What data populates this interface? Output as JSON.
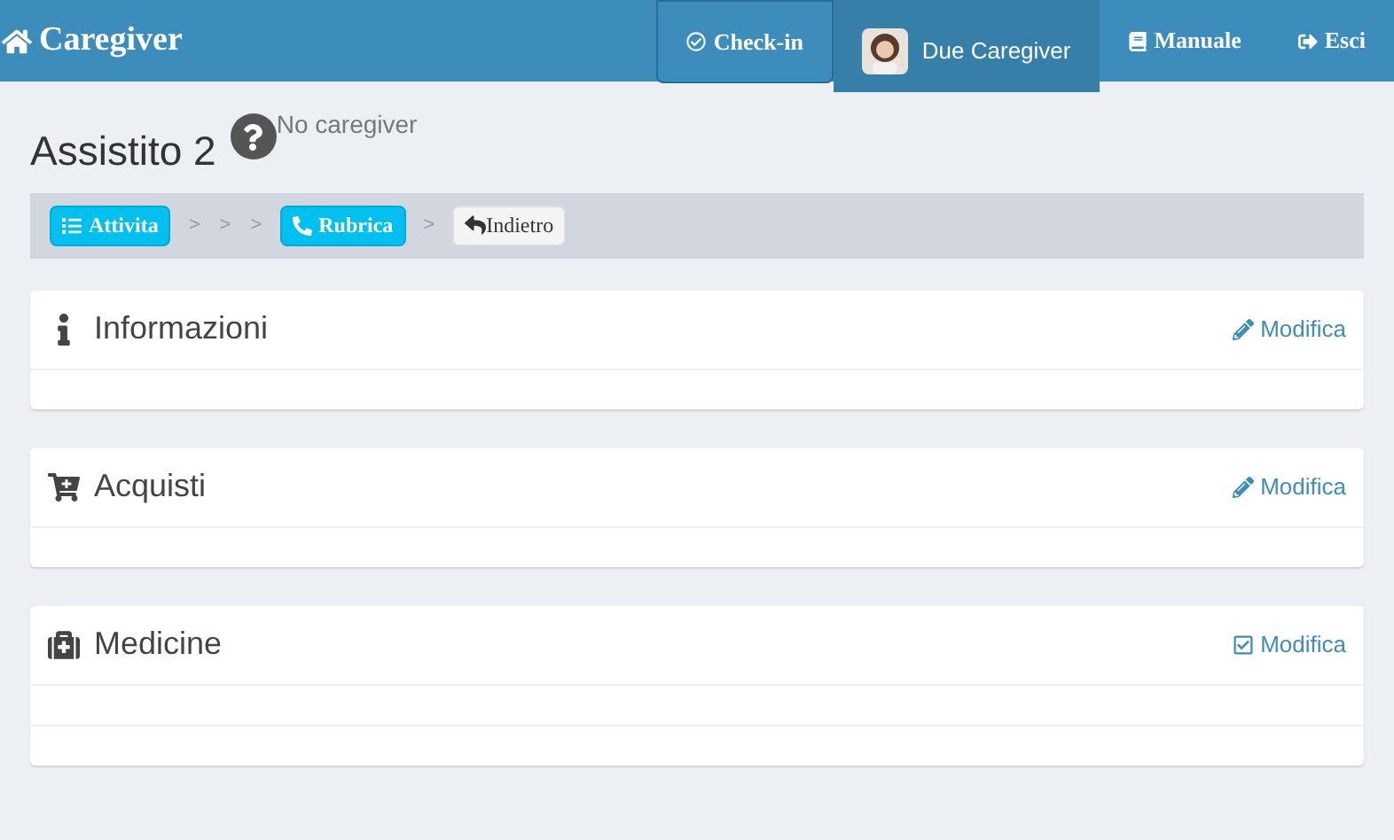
{
  "navbar": {
    "brand": "Caregiver",
    "items": [
      {
        "kind": "checkin",
        "label": "Check-in",
        "selected": false,
        "focused": true
      },
      {
        "kind": "user",
        "label": "Due Caregiver",
        "selected": true,
        "focused": false
      },
      {
        "kind": "manual",
        "label": "Manuale",
        "selected": false,
        "focused": false
      },
      {
        "kind": "exit",
        "label": "Esci",
        "selected": false,
        "focused": false
      }
    ]
  },
  "header": {
    "title": "Assistito 2",
    "caregiver": "No caregiver"
  },
  "breadcrumb": [
    {
      "kind": "button",
      "label": "Attivita"
    },
    {
      "kind": "separator",
      "label": ">"
    },
    {
      "kind": "separator",
      "label": ">"
    },
    {
      "kind": "separator",
      "label": ">"
    },
    {
      "kind": "button",
      "label": "Rubrica"
    },
    {
      "kind": "separator",
      "label": ">"
    },
    {
      "kind": "back",
      "label": "Indietro"
    }
  ],
  "panels": [
    {
      "title": "Informazioni",
      "link": "Modifica",
      "extra_row": false
    },
    {
      "title": "Acquisti",
      "link": "Modifica",
      "extra_row": false
    },
    {
      "title": "Medicine",
      "link": "Modifica",
      "extra_row": true
    }
  ]
}
